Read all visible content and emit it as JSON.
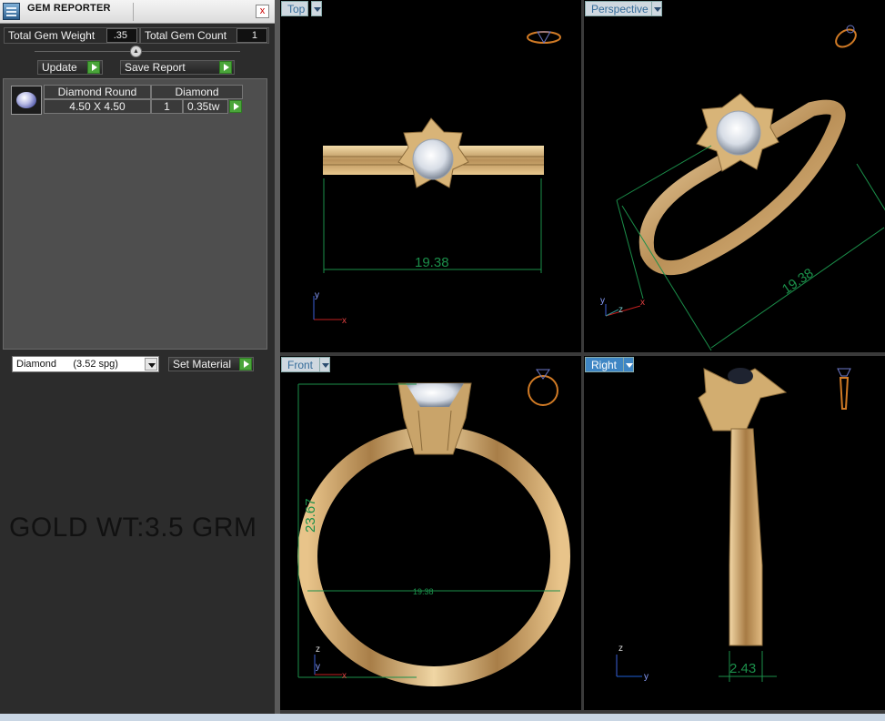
{
  "window": {
    "title": "GEM REPORTER",
    "close_symbol": "x"
  },
  "stats": {
    "total_weight_label": "Total Gem Weight",
    "total_weight_value": ".35",
    "total_count_label": "Total Gem Count",
    "total_count_value": "1"
  },
  "buttons": {
    "update": "Update",
    "save_report": "Save Report",
    "set_material": "Set Material"
  },
  "gem_table": {
    "shape_header": "Diamond Round",
    "size": "4.50 X 4.50",
    "material_header": "Diamond",
    "count": "1",
    "weight": "0.35tw"
  },
  "material_select": {
    "selected": "Diamond      (3.52 spg)"
  },
  "annotation": "GOLD WT:3.5 GRM",
  "viewports": {
    "top": {
      "label": "Top",
      "dimension": "19.38",
      "axis_y": "y",
      "axis_x": "x"
    },
    "perspective": {
      "label": "Perspective",
      "dimension": "19.38",
      "axis_y": "y",
      "axis_z": "z",
      "axis_x": "x"
    },
    "front": {
      "label": "Front",
      "height_dim": "23.67",
      "width_dim": "19.38",
      "axis_z": "z",
      "axis_y": "y",
      "axis_x": "x"
    },
    "right": {
      "label": "Right",
      "dimension": "2.43",
      "axis_z": "z",
      "axis_y": "y"
    }
  },
  "colors": {
    "metal": "#d9b67e",
    "dimension_line": "#1b8f4a",
    "active_label": "#3f86c4"
  }
}
